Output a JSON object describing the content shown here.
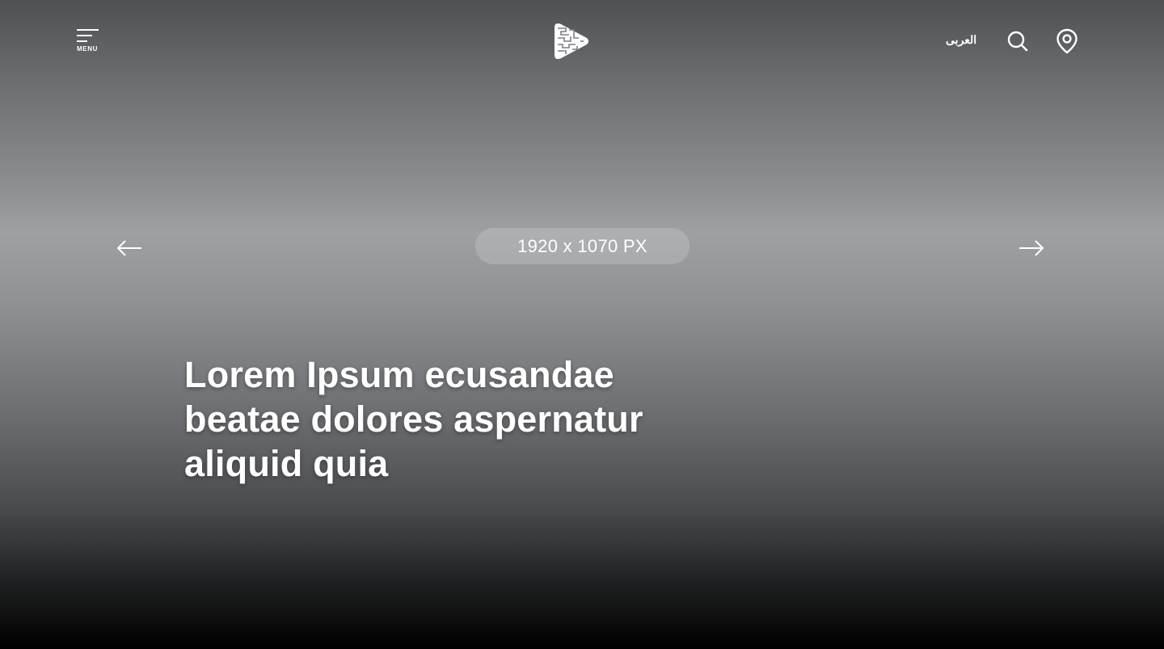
{
  "header": {
    "menu_label": "MENU",
    "language_link": "العربى",
    "icons": {
      "menu": "hamburger-menu-icon",
      "logo": "brand-logo",
      "search": "search-icon",
      "location": "location-pin-icon"
    }
  },
  "slider": {
    "placeholder_label": "1920 x 1070 PX",
    "headline": "Lorem Ipsum ecusandae beatae dolores aspernatur aliquid quia",
    "prev_icon": "arrow-left-icon",
    "next_icon": "arrow-right-icon"
  },
  "colors": {
    "text": "#ffffff",
    "gradient_top": "#4e5053",
    "gradient_mid": "#9ea1a4",
    "gradient_bottom": "#000000"
  }
}
